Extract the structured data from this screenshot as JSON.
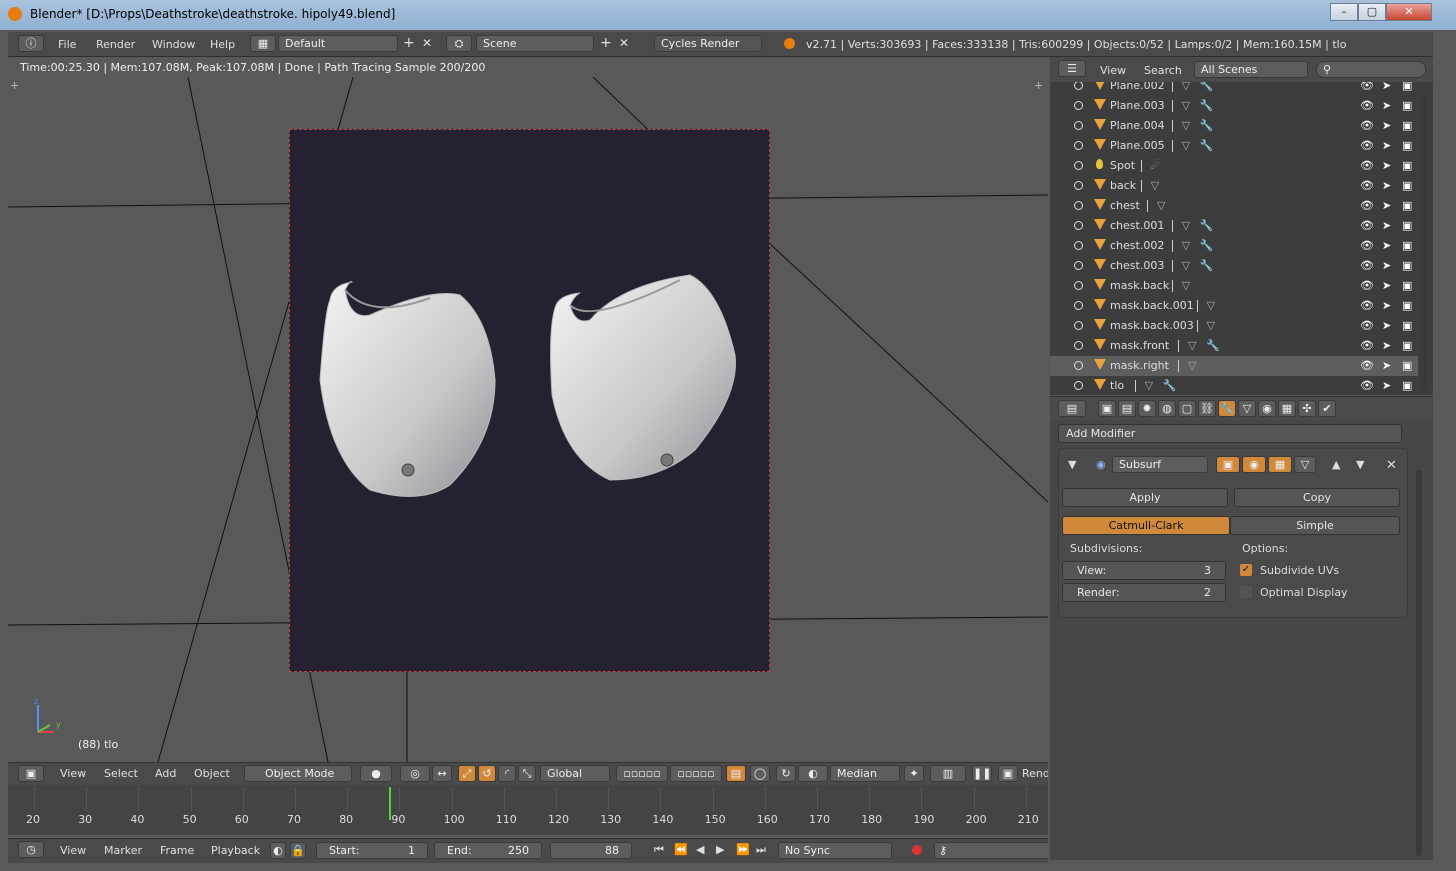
{
  "window": {
    "title": "Blender* [D:\\Props\\Deathstroke\\deathstroke. hipoly49.blend]",
    "min": "–",
    "max": "▢",
    "close": "✕"
  },
  "top_menu": [
    "File",
    "Render",
    "Window",
    "Help"
  ],
  "layout": {
    "value": "Default"
  },
  "scene": {
    "value": "Scene"
  },
  "engine": {
    "value": "Cycles Render"
  },
  "stats": "v2.71 | Verts:303693 | Faces:333138 | Tris:600299 | Objects:0/52 | Lamps:0/2 | Mem:160.15M | tlo",
  "viewport": {
    "info": "Time:00:25.30 | Mem:107.08M, Peak:107.08M | Done | Path Tracing Sample 200/200",
    "object_label": "(88) tlo",
    "axis_x": "x",
    "axis_y": "y",
    "axis_z": "z"
  },
  "view3d_header": {
    "menus": [
      "View",
      "Select",
      "Add",
      "Object"
    ],
    "mode": "Object Mode",
    "orientation": "Global",
    "pivot": "Median",
    "render_label": "Rend"
  },
  "timeline": {
    "ticks": [
      "20",
      "30",
      "40",
      "50",
      "60",
      "70",
      "80",
      "90",
      "100",
      "110",
      "120",
      "130",
      "140",
      "150",
      "160",
      "170",
      "180",
      "190",
      "200",
      "210"
    ],
    "current_frame": 88,
    "menus": [
      "View",
      "Marker",
      "Frame",
      "Playback"
    ],
    "start_label": "Start:",
    "start_value": "1",
    "end_label": "End:",
    "end_value": "250",
    "frame_value": "88",
    "sync": "No Sync"
  },
  "outliner": {
    "menus": [
      "View",
      "Search"
    ],
    "filter": "All Scenes",
    "items": [
      {
        "name": "Plane.002",
        "modifier": true
      },
      {
        "name": "Plane.003",
        "modifier": true
      },
      {
        "name": "Plane.004",
        "modifier": true
      },
      {
        "name": "Plane.005",
        "modifier": true
      },
      {
        "name": "Spot",
        "lamp": true
      },
      {
        "name": "back",
        "modifier": false
      },
      {
        "name": "chest",
        "modifier": false
      },
      {
        "name": "chest.001",
        "modifier": true
      },
      {
        "name": "chest.002",
        "modifier": true
      },
      {
        "name": "chest.003",
        "modifier": true
      },
      {
        "name": "mask.back",
        "modifier": false
      },
      {
        "name": "mask.back.001",
        "modifier": false
      },
      {
        "name": "mask.back.003",
        "modifier": false
      },
      {
        "name": "mask.front",
        "modifier": true
      },
      {
        "name": "mask.right",
        "modifier": false,
        "selected": true
      },
      {
        "name": "tlo",
        "modifier": true
      }
    ]
  },
  "properties": {
    "add_modifier": "Add Modifier",
    "modifier_name": "Subsurf",
    "apply": "Apply",
    "copy": "Copy",
    "catmull": "Catmull-Clark",
    "simple": "Simple",
    "subdivisions_label": "Subdivisions:",
    "options_label": "Options:",
    "view_label": "View:",
    "view_value": "3",
    "render_label": "Render:",
    "render_value": "2",
    "subdivide_uvs": "Subdivide UVs",
    "optimal_display": "Optimal Display",
    "colors": {
      "accent": "#d0883a"
    }
  }
}
